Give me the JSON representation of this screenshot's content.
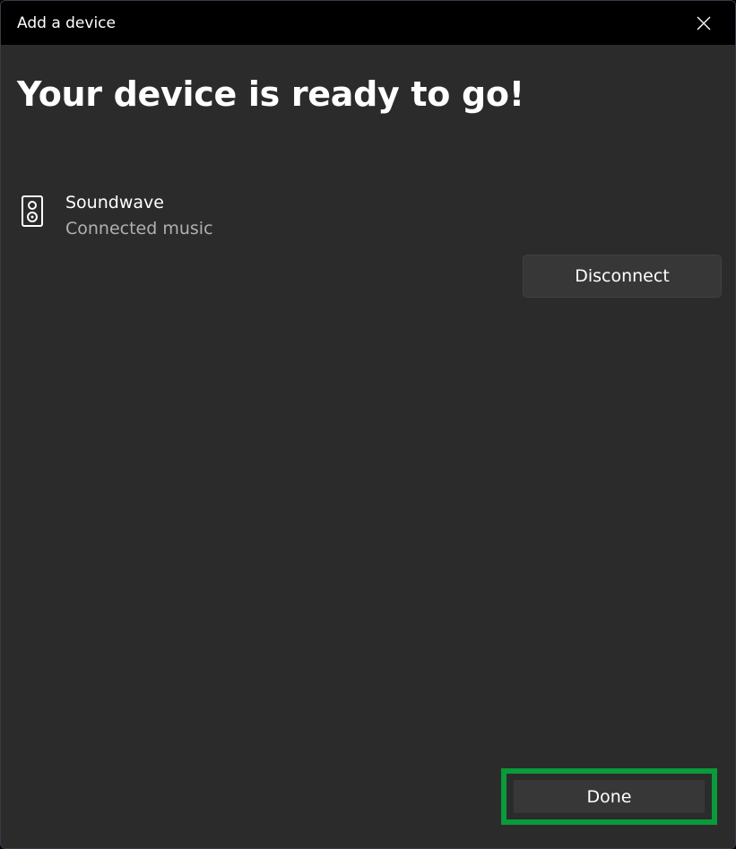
{
  "window": {
    "title": "Add a device"
  },
  "main": {
    "heading": "Your device is ready to go!",
    "device": {
      "name": "Soundwave",
      "status": "Connected music",
      "icon": "speaker-icon"
    },
    "disconnect_label": "Disconnect"
  },
  "footer": {
    "done_label": "Done",
    "highlight_color": "#0a9a3a"
  },
  "icons": {
    "close": "close-icon"
  }
}
